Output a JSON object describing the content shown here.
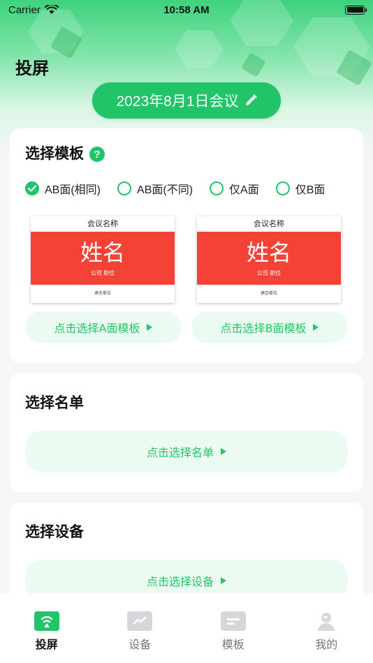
{
  "status_bar": {
    "carrier": "Carrier",
    "time": "10:58 AM"
  },
  "page": {
    "title": "投屏",
    "meeting_name": "2023年8月1日会议"
  },
  "template_card": {
    "title": "选择模板",
    "options": [
      {
        "label": "AB面(相同)",
        "checked": true
      },
      {
        "label": "AB面(不同)",
        "checked": false
      },
      {
        "label": "仅A面",
        "checked": false
      },
      {
        "label": "仅B面",
        "checked": false
      }
    ],
    "preview": {
      "meeting_title": "会议名称",
      "name": "姓名",
      "company_position": "公司  职位",
      "organizer": "承办单位"
    },
    "select_a_label": "点击选择A面模板",
    "select_b_label": "点击选择B面模板"
  },
  "list_card": {
    "title": "选择名单",
    "select_label": "点击选择名单"
  },
  "device_card": {
    "title": "选择设备",
    "select_label": "点击选择设备"
  },
  "tabs": [
    {
      "label": "投屏",
      "icon": "cast-icon",
      "active": true
    },
    {
      "label": "设备",
      "icon": "monitor-icon",
      "active": false
    },
    {
      "label": "模板",
      "icon": "template-icon",
      "active": false
    },
    {
      "label": "我的",
      "icon": "user-icon",
      "active": false
    }
  ],
  "colors": {
    "accent": "#22c46a",
    "badge_red": "#f44336",
    "pill_bg": "#ecfbf2"
  }
}
